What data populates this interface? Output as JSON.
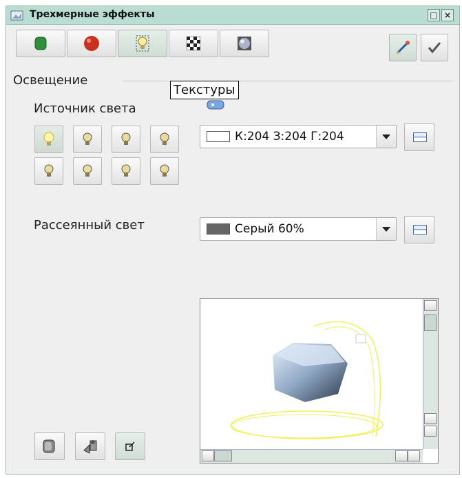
{
  "window": {
    "title": "Трехмерные эффекты",
    "controls": [
      "restore-icon",
      "close-icon"
    ]
  },
  "toolbar": {
    "tabs": [
      {
        "name": "geometry",
        "icon": "green-cube-icon"
      },
      {
        "name": "shading",
        "icon": "red-sphere-icon"
      },
      {
        "name": "illumination",
        "icon": "lightbulb-icon",
        "active": true
      },
      {
        "name": "textures",
        "icon": "checkerboard-icon"
      },
      {
        "name": "material",
        "icon": "material-sphere-icon"
      }
    ],
    "right_buttons": [
      {
        "name": "pipette",
        "icon": "pipette-icon",
        "active": true
      },
      {
        "name": "assign",
        "icon": "checkmark-icon"
      }
    ]
  },
  "section": {
    "title": "Освещение",
    "light_source_label": "Источник света",
    "ambient_label": "Рассеянный свет"
  },
  "tooltip": "Текстуры",
  "lights": {
    "count": 8,
    "active_index": 0
  },
  "light_color_combo": {
    "value": "К:204 З:204 Г:204",
    "swatch_color": "#cccccc"
  },
  "ambient_combo": {
    "value": "Серый 60%",
    "swatch_color": "#666666"
  },
  "colors": {
    "titlebar": "#b9dcd3",
    "accent": "#9db6a6",
    "light_bulb": "#f5e44a"
  },
  "bottom_buttons": [
    {
      "name": "convert-3d",
      "icon": "convert-3d-icon"
    },
    {
      "name": "perspective",
      "icon": "perspective-icon"
    },
    {
      "name": "light-on-off",
      "icon": "light-toggle-icon",
      "active": true
    }
  ]
}
